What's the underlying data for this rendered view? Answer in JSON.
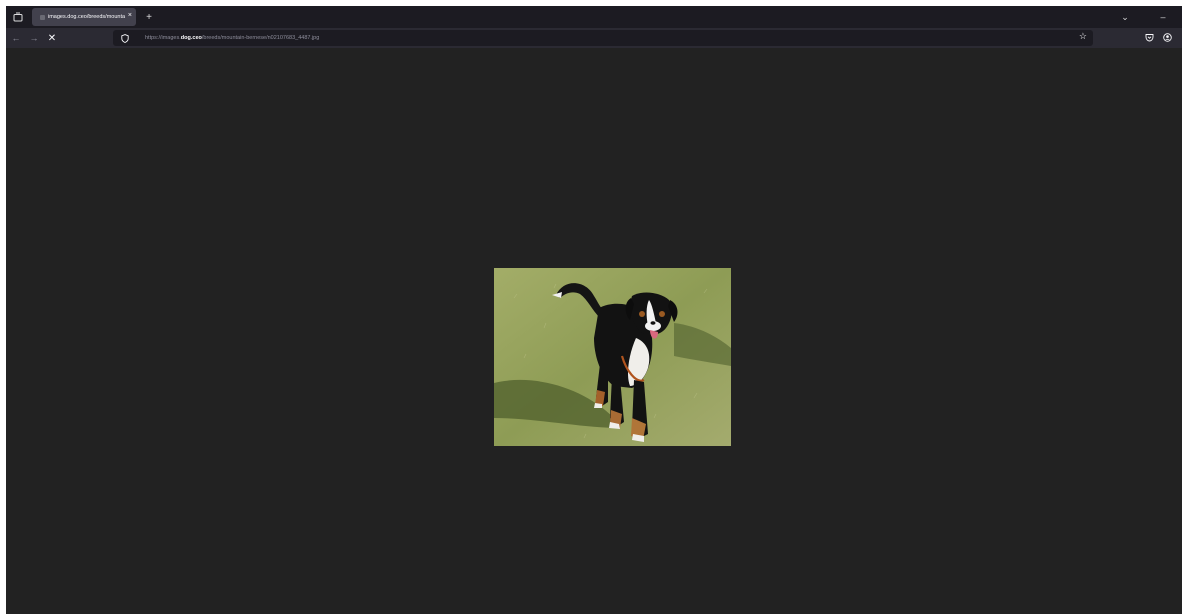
{
  "browser": {
    "tab": {
      "title": "images.dog.ceo/breeds/mounta",
      "close_glyph": "×"
    },
    "new_tab_glyph": "+",
    "list_tabs_glyph": "⌄",
    "minimize_glyph": "–",
    "nav": {
      "back_glyph": "←",
      "forward_glyph": "→",
      "stop_glyph": "✕"
    },
    "url": {
      "prefix": "https://images.",
      "domain": "dog.ceo",
      "path": "/breeds/mountain-bernese/n02107683_4487.jpg"
    },
    "bookmark_glyph": "☆"
  },
  "content": {
    "image_description": "Bernese mountain dog standing on grass",
    "background": "#222222"
  },
  "icons": {
    "overview": "tab-overview-icon",
    "shield": "shield-icon",
    "pocket": "pocket-icon",
    "account": "account-icon"
  }
}
